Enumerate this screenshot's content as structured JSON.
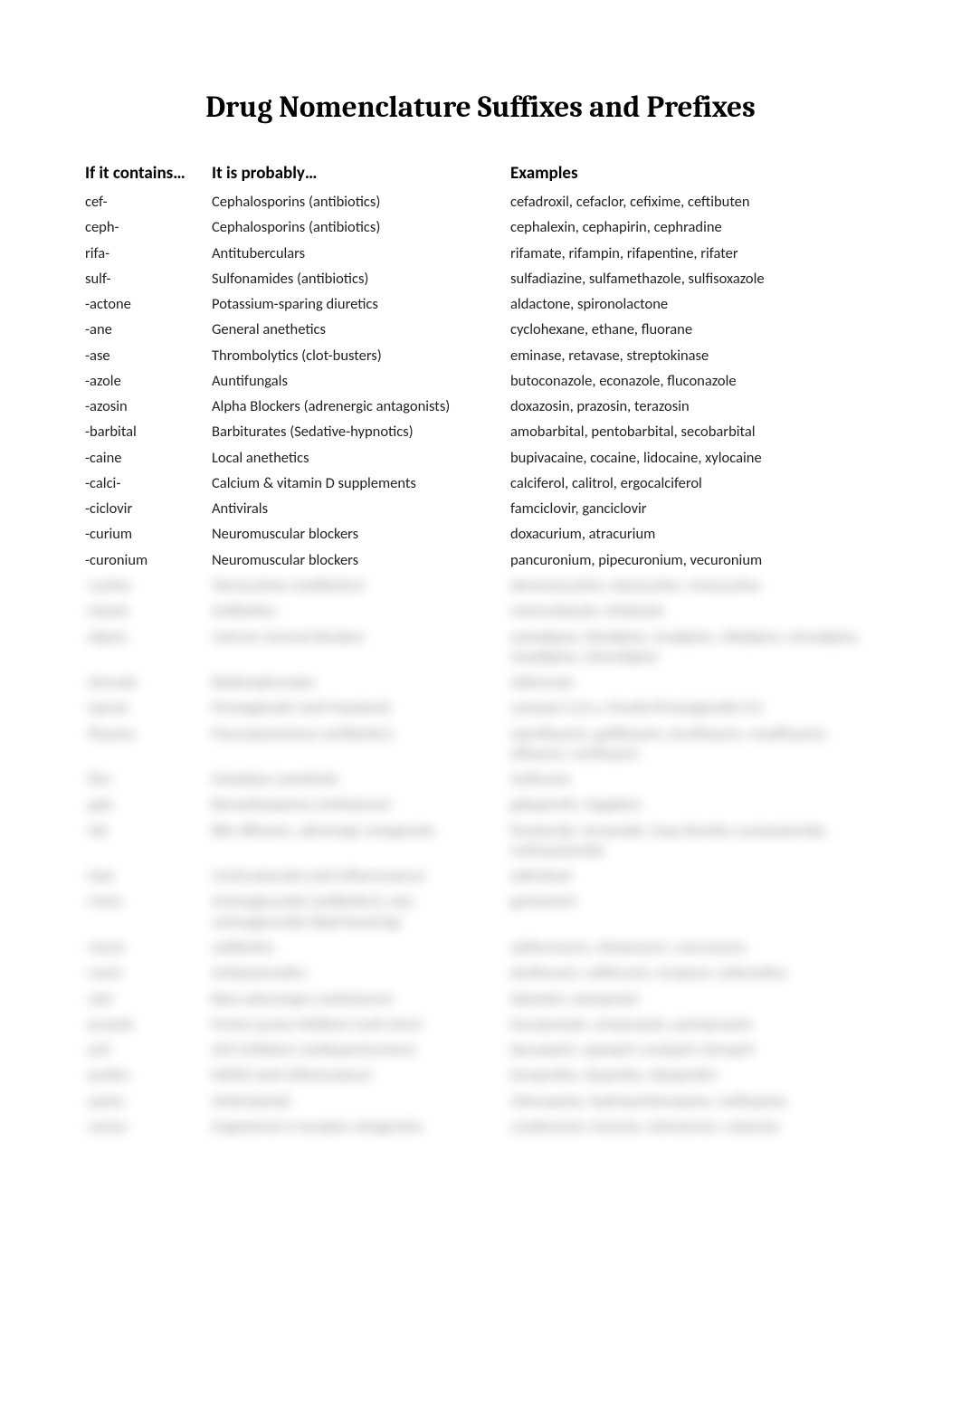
{
  "title": "Drug Nomenclature Suffixes and Prefixes",
  "headers": {
    "col1": "If it contains…",
    "col2": "It is probably…",
    "col3": "Examples"
  },
  "rows": [
    {
      "contains": "cef-",
      "probably": "Cephalosporins (antibiotics)",
      "examples": "cefadroxil, cefaclor, cefixime, ceftibuten"
    },
    {
      "contains": "ceph-",
      "probably": "Cephalosporins (antibiotics)",
      "examples": "cephalexin, cephapirin, cephradine"
    },
    {
      "contains": "rifa-",
      "probably": "Antituberculars",
      "examples": "rifamate, rifampin, rifapentine, rifater"
    },
    {
      "contains": "sulf-",
      "probably": "Sulfonamides (antibiotics)",
      "examples": "sulfadiazine, sulfamethazole, sulfisoxazole"
    },
    {
      "contains": " -actone",
      "probably": "Potassium-sparing diuretics",
      "examples": "aldactone, spironolactone"
    },
    {
      "contains": " -ane",
      "probably": "General anethetics",
      "examples": "cyclohexane, ethane, fluorane"
    },
    {
      "contains": "-ase",
      "probably": "Thrombolytics (clot-busters)",
      "examples": "eminase, retavase, streptokinase"
    },
    {
      "contains": "-azole",
      "probably": "Auntifungals",
      "examples": "butoconazole, econazole, fluconazole"
    },
    {
      "contains": "-azosin",
      "probably": "Alpha Blockers (adrenergic antagonists)",
      "examples": "doxazosin, prazosin, terazosin"
    },
    {
      "contains": "-barbital",
      "probably": "Barbiturates (Sedative-hypnotics)",
      "examples": "amobarbital, pentobarbital, secobarbital"
    },
    {
      "contains": "-caine",
      "probably": "Local anethetics",
      "examples": "bupivacaine, cocaine, lidocaine, xylocaine"
    },
    {
      "contains": "-calci-",
      "probably": "Calcium & vitamin D supplements",
      "examples": "calciferol, calitrol, ergocalciferol"
    },
    {
      "contains": "-ciclovir",
      "probably": "Antivirals",
      "examples": "famciclovir, ganciclovir"
    },
    {
      "contains": "-curium",
      "probably": "Neuromuscular blockers",
      "examples": "doxacurium, atracurium"
    },
    {
      "contains": "-curonium",
      "probably": "Neuromuscular blockers",
      "examples": "pancuronium, pipecuronium, vecuronium"
    }
  ],
  "blurred_rows": [
    {
      "contains": "-cycline",
      "probably": "Tetracyclines (antibiotics)",
      "examples": "demeclocycline, doxycycline, minocycline"
    },
    {
      "contains": "-dazole",
      "probably": "Antibiotics",
      "examples": "metronidazole, tinidazole"
    },
    {
      "contains": "-dipine",
      "probably": "Calcium channel blockers",
      "examples": "amlodipine, felodipine, isradipine, nifedipine, nimodipine, nisoldipine, nitrendipine"
    },
    {
      "contains": "-dronate",
      "probably": "Bisphosphonates",
      "examples": "etidronate"
    },
    {
      "contains": "-eprost",
      "probably": "Prostaglandin (anti-impotent)",
      "examples": "caverject (a.k.a. Prostin/Prostaglandin E1)"
    },
    {
      "contains": "-floxacin",
      "probably": "Fluoroquinolones (antibiotics)",
      "examples": "ciprofloxacin, gatifloxacin, levofloxacin, moxifloxacin, ofloxacin, norfloxacin"
    },
    {
      "contains": "-flur-",
      "probably": "Inhalation anesthetic",
      "examples": "isoflurane"
    },
    {
      "contains": "-gab-",
      "probably": "Benzodiazepines (antiseizure)",
      "examples": "gabapentin, tiagabine"
    },
    {
      "contains": "-ide",
      "probably": "Bile effluents, adrenergic antagonists",
      "examples": "finasteride, terazoside, loop diuretics acetazolamide, methazolamide"
    },
    {
      "contains": "-ilast",
      "probably": "Corticosteroids (anti-inflammatory)",
      "examples": "zafirlukast"
    },
    {
      "contains": "-micin",
      "probably": "Aminoglycoside (antibiotics); also aminoglycoside (lipid-lowering)",
      "examples": "gentamicin"
    },
    {
      "contains": "-mycin",
      "probably": "antibiotics",
      "examples": "azithromycin, clindamycin, vancomycin"
    },
    {
      "contains": "-nacin",
      "probably": "Antispasmodics",
      "examples": "darifenacin, solifenacin, trospium, tolterodine"
    },
    {
      "contains": "-olol",
      "probably": "Beta-adrenergics (antiseizure)",
      "examples": "labetalol, metoprolol"
    },
    {
      "contains": "-prazole",
      "probably": "Proton pump inhibitors (anti-ulcer)",
      "examples": "lansoprazole, omeprazole, pantoprazole"
    },
    {
      "contains": "-pril",
      "probably": "ACE inhibitors (antihypertensives)",
      "examples": "benazepril, captopril, enalapril, lisinopril"
    },
    {
      "contains": "-profen",
      "probably": "NSAID (anti-inflammatory)",
      "examples": "fenoprofen, ibuprofen, ketoprofen"
    },
    {
      "contains": "-quine",
      "probably": "Antimalarials",
      "examples": "chloroquine, hydroxychloroquine, mefloquine"
    },
    {
      "contains": "-sartan",
      "probably": "Angiotensin II receptor antagonists",
      "examples": "candesartan, losartan, telmisartan, valsartan"
    }
  ]
}
